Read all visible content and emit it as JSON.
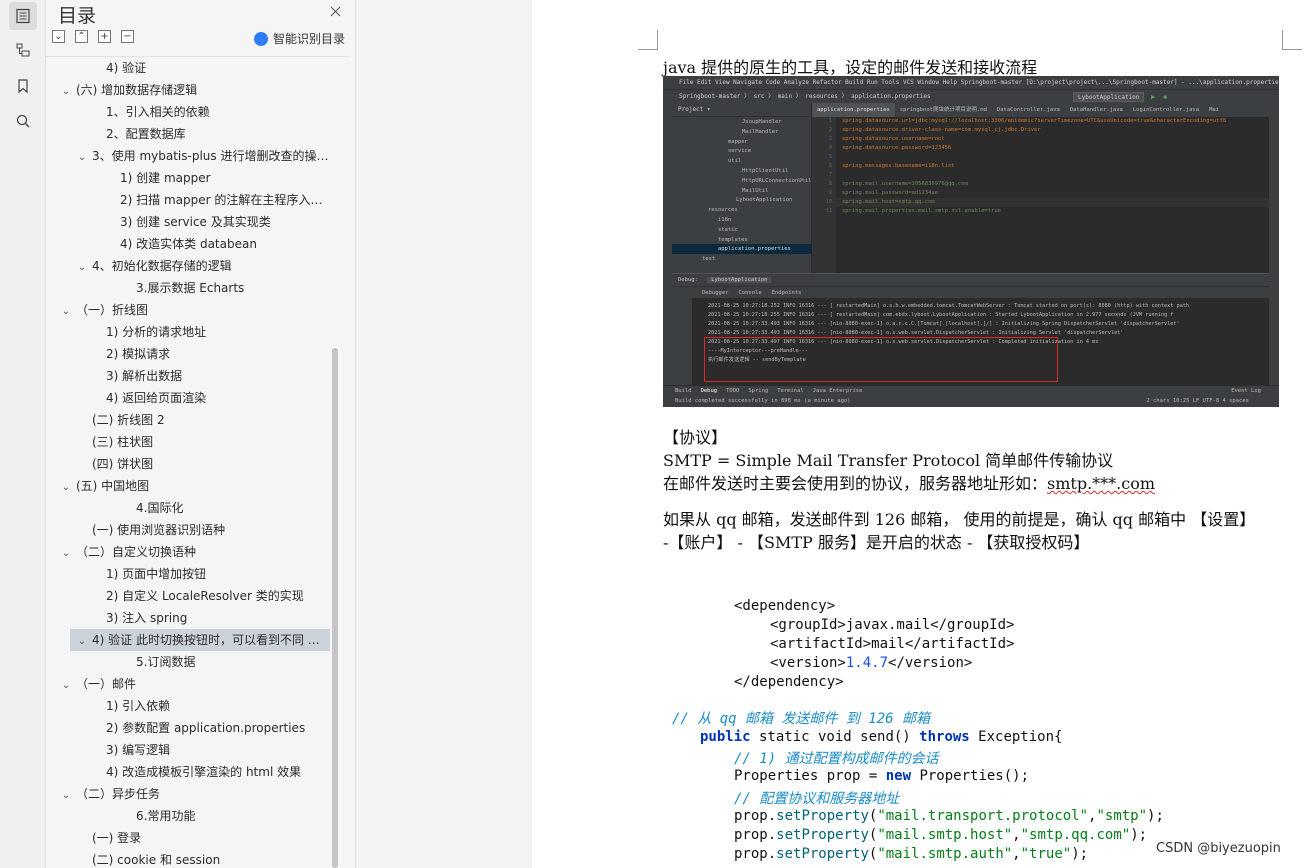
{
  "sidebar": {
    "title": "目录",
    "smart_toc": "智能识别目录",
    "tools": [
      "⌄",
      "⌃",
      "+",
      "−"
    ],
    "items": [
      {
        "label": "4) 验证",
        "indent": 3,
        "arrow": ""
      },
      {
        "label": "(六) 增加数据存储逻辑",
        "indent": 1,
        "arrow": "⌄"
      },
      {
        "label": "1、引入相关的依赖",
        "indent": 3,
        "arrow": ""
      },
      {
        "label": "2、配置数据库",
        "indent": 3,
        "arrow": ""
      },
      {
        "label": "3、使用 mybatis-plus 进行增删改查的操…",
        "indent": 2,
        "arrow": "⌄"
      },
      {
        "label": "1)   创建 mapper",
        "indent": 4,
        "arrow": ""
      },
      {
        "label": "2) 扫描 mapper 的注解在主程序入口 …",
        "indent": 4,
        "arrow": ""
      },
      {
        "label": "3) 创建 service 及其实现类",
        "indent": 4,
        "arrow": ""
      },
      {
        "label": "4) 改造实体类 databean",
        "indent": 4,
        "arrow": ""
      },
      {
        "label": "4、初始化数据存储的逻辑",
        "indent": 2,
        "arrow": "⌄"
      },
      {
        "label": "3.展示数据 Echarts",
        "indent": 5,
        "arrow": ""
      },
      {
        "label": "（一）折线图",
        "indent": 1,
        "arrow": "⌄"
      },
      {
        "label": "1) 分析的请求地址",
        "indent": 3,
        "arrow": ""
      },
      {
        "label": "2) 模拟请求",
        "indent": 3,
        "arrow": ""
      },
      {
        "label": "3) 解析出数据",
        "indent": 3,
        "arrow": ""
      },
      {
        "label": "4) 返回给页面渲染",
        "indent": 3,
        "arrow": ""
      },
      {
        "label": "(二) 折线图 2",
        "indent": 2,
        "arrow": ""
      },
      {
        "label": "(三) 柱状图",
        "indent": 2,
        "arrow": ""
      },
      {
        "label": "(四) 饼状图",
        "indent": 2,
        "arrow": ""
      },
      {
        "label": "(五) 中国地图",
        "indent": 1,
        "arrow": "⌄"
      },
      {
        "label": "4.国际化",
        "indent": 5,
        "arrow": ""
      },
      {
        "label": "(一)  使用浏览器识别语种",
        "indent": 2,
        "arrow": ""
      },
      {
        "label": "（二）自定义切换语种",
        "indent": 1,
        "arrow": "⌄"
      },
      {
        "label": "1)   页面中增加按钮",
        "indent": 3,
        "arrow": ""
      },
      {
        "label": "2) 自定义 LocaleResolver 类的实现",
        "indent": 3,
        "arrow": ""
      },
      {
        "label": "3) 注入 spring",
        "indent": 3,
        "arrow": ""
      },
      {
        "label": "4) 验证 此时切换按钮时，可以看到不同 …",
        "indent": 2,
        "arrow": "⌄",
        "selected": true
      },
      {
        "label": "5.订阅数据",
        "indent": 5,
        "arrow": ""
      },
      {
        "label": "（一）邮件",
        "indent": 1,
        "arrow": "⌄"
      },
      {
        "label": "1) 引入依赖",
        "indent": 3,
        "arrow": ""
      },
      {
        "label": "2) 参数配置 application.properties",
        "indent": 3,
        "arrow": ""
      },
      {
        "label": "3) 编写逻辑",
        "indent": 3,
        "arrow": ""
      },
      {
        "label": "4) 改造成模板引擎渲染的 html 效果",
        "indent": 3,
        "arrow": ""
      },
      {
        "label": "（二）异步任务",
        "indent": 1,
        "arrow": "⌄"
      },
      {
        "label": "6.常用功能",
        "indent": 5,
        "arrow": ""
      },
      {
        "label": "(一)  登录",
        "indent": 2,
        "arrow": ""
      },
      {
        "label": "(二)  cookie 和 session",
        "indent": 2,
        "arrow": ""
      }
    ]
  },
  "doc": {
    "heading1": "java 提供的原生的工具，设定的邮件发送和接收流程",
    "protocol_label": "【协议】",
    "smtp_line": "SMTP = Simple Mail Transfer Protocol 简单邮件传输协议",
    "server_line_prefix": "在邮件发送时主要会使用到的协议，服务器地址形如：",
    "server_line_addr": "smtp.***.com",
    "qq_line1": "如果从 qq 邮箱，发送邮件到 126 邮箱， 使用的前提是，确认 qq 邮箱中 【设置】",
    "qq_line2": "-【账户】 - 【SMTP 服务】是开启的状态 - 【获取授权码】",
    "dep_open": "<dependency>",
    "group_id": "<groupId>javax.mail</groupId>",
    "artifact_id": "<artifactId>mail</artifactId>",
    "version_open": "<version>",
    "version_num": "1.4.7",
    "version_close": "</version>",
    "dep_close": "</dependency>",
    "comment1": "// 从 qq 邮箱   发送邮件   到 126 邮箱",
    "sig_public": "public",
    "sig_mid": " static void send() ",
    "sig_throws": "throws",
    "sig_end": " Exception{",
    "comment2": "// 1) 通过配置构成邮件的会话",
    "props_start": "Properties prop = ",
    "props_new": "new",
    "props_end": " Properties();",
    "comment3": "// 配置协议和服务器地址",
    "set1_key": "\"mail.transport.protocol\"",
    "set1_val": "\"smtp\"",
    "set2_key": "\"mail.smtp.host\"",
    "set2_val": "\"smtp.qq.com\"",
    "set3_key": "\"mail.smtp.auth\"",
    "set3_val": "\"true\"",
    "prop_prefix": "prop.",
    "set_method": "setProperty",
    "watermark": "CSDN @biyezuopin"
  },
  "ide": {
    "menu": "File  Edit  View  Navigate  Code  Analyze  Refactor  Build  Run  Tools  VCS  Window  Help    Springboot-master [D:\\project\\project\\...\\Springboot-master] - ...\\application.properties",
    "nav": "Springboot-master  〉 src  〉 main  〉 resources  〉 application.properties",
    "run_config": "LybootApplication",
    "project_label": "Project",
    "tree": [
      "JsoupHandler",
      "MailHandler",
      "mapper",
      "service",
      "util",
      "HttpClientUtil",
      "HttpURLConnectionUtil",
      "MailUtil",
      "LybootApplication",
      "resources",
      "i18n",
      "static",
      "templates",
      "application.properties",
      "test"
    ],
    "tabs": [
      "application.properties",
      "springboot爬虫统计项目说明.md",
      "DataController.java",
      "DataHandler.java",
      "LoginController.java",
      "Mai"
    ],
    "code": [
      "spring.datasource.url=jdbc:mysql://localhost:3306/epidemic?serverTimezone=UTC&useUnicode=true&characterEncoding=utf8",
      "spring.datasource.driver-class-name=com.mysql.cj.jdbc.Driver",
      "spring.datasource.username=root",
      "spring.datasource.password=123456",
      "",
      "spring.messages.basename=i18n.list",
      "",
      "spring.mail.username=3056836976@qq.com",
      "spring.mail.password=ad1234ae",
      "spring.mail.host=smtp.qq.com",
      "spring.mail.properties.mail.smtp.ssl.enable=true"
    ],
    "debug_title": "Debug:",
    "debug_app": "LybootApplication",
    "debug_tabs": [
      "Debugger",
      "Console",
      "Endpoints"
    ],
    "log": [
      "2021-08-25 10:27:18.252  INFO 16316 --- [  restartedMain] o.s.b.w.embedded.tomcat.TomcatWebServer  : Tomcat started on port(s): 8080 (http) with context path",
      "2021-08-25 10:27:18.255  INFO 16316 --- [  restartedMain] com.ebdx.lyboot.LybootApplication        : Started LybootApplication in 2.977 seconds (JVM running f",
      "2021-08-25 10:27:33.493  INFO 16316 --- [nio-8080-exec-1] o.a.c.c.C.[Tomcat].[localhost].[/]       : Initializing Spring DispatcherServlet 'dispatcherServlet'",
      "2021-08-25 10:27:33.493  INFO 16316 --- [nio-8080-exec-1] o.s.web.servlet.DispatcherServlet        : Initializing Servlet 'dispatcherServlet'",
      "2021-08-25 10:27:33.497  INFO 16316 --- [nio-8080-exec-1] o.s.web.servlet.DispatcherServlet        : Completed initialization in 4 ms",
      "----MyInterceptor---preHandle---",
      "执行邮件发送逻辑 --  sendByTemplate"
    ],
    "bottom_tabs": [
      "Build",
      "Debug",
      "TODO",
      "Spring",
      "Terminal",
      "Java Enterprise"
    ],
    "status_left": "Build completed successfully in 898 ms (a minute ago)",
    "status_right": "2 chars   10:25   LF   UTF-8   4 spaces",
    "event_log": "Event Log"
  }
}
